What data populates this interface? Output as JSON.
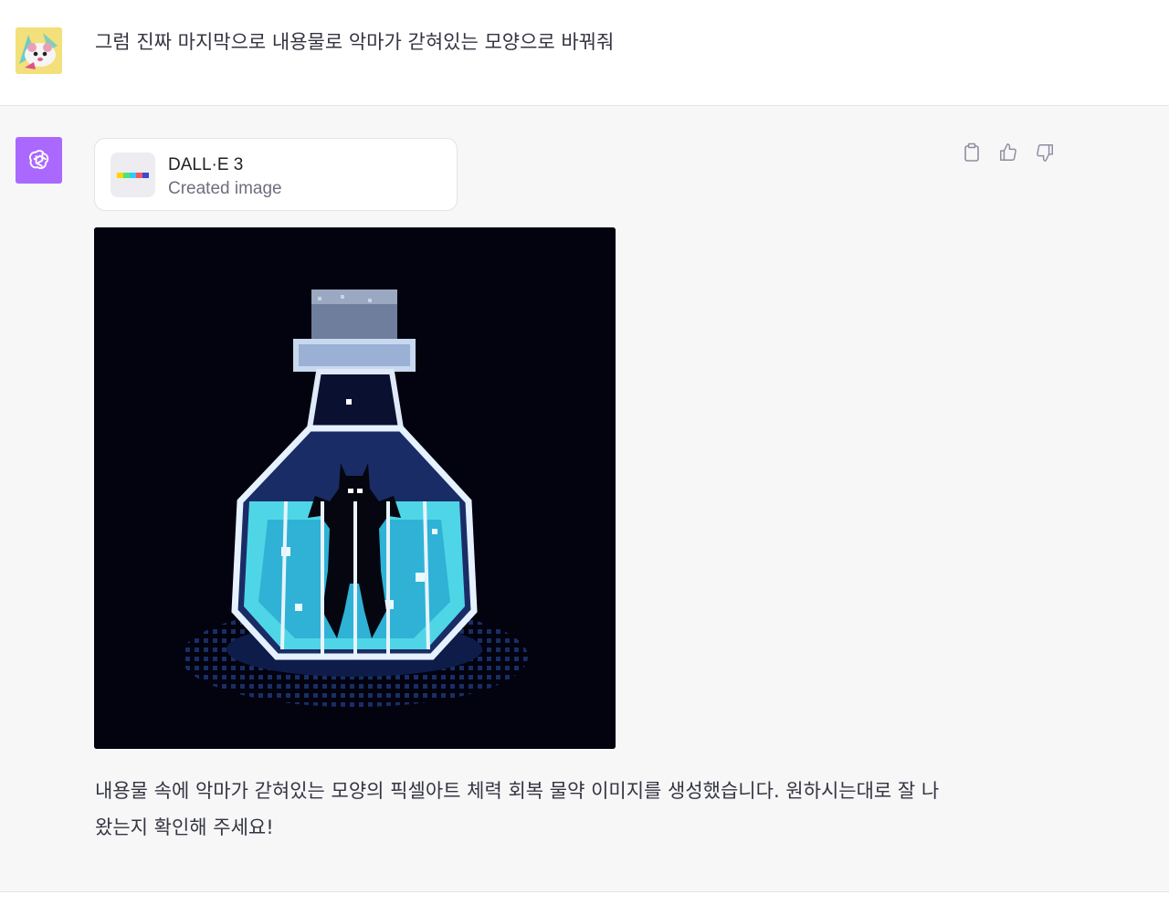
{
  "user": {
    "message": "그럼 진짜 마지막으로 내용물로 악마가 갇혀있는 모양으로 바꿔줘"
  },
  "assistant": {
    "tool": {
      "name": "DALL·E 3",
      "status": "Created image"
    },
    "response": "내용물 속에 악마가 갇혀있는 모양의 픽셀아트 체력 회복 물약 이미지를 생성했습니다. 원하시는대로 잘 나왔는지 확인해 주세요!"
  },
  "icons": {
    "copy": "clipboard-icon",
    "like": "thumbs-up-icon",
    "dislike": "thumbs-down-icon",
    "assistant_logo": "openai-logo-icon"
  },
  "colors": {
    "assistant_avatar_bg": "#ab68ff",
    "assistant_row_bg": "#f7f7f8",
    "image_bg": "#03020f",
    "liquid": "#4fd6e6"
  }
}
